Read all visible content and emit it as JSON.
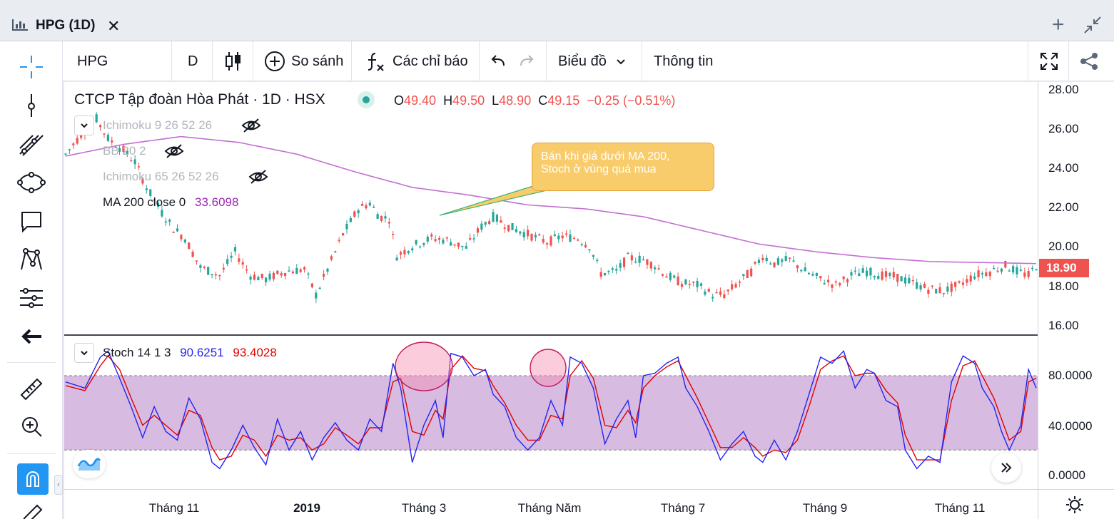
{
  "window": {
    "title": "HPG (1D)",
    "close_glyph": "✕",
    "add_glyph": "+"
  },
  "toolbar": {
    "symbol": "HPG",
    "interval": "D",
    "compare_label": "So sánh",
    "indicators_label": "Các chỉ báo",
    "chart_type_label": "Biểu đồ",
    "info_label": "Thông tin",
    "icons": [
      "candles-icon",
      "add-circle-icon",
      "fx-icon",
      "undo-icon",
      "redo-icon",
      "chevron-down-icon",
      "fullscreen-icon",
      "share-icon"
    ]
  },
  "left_tools": [
    "crosshair-icon",
    "trendline-icon",
    "fib-icon",
    "ellipse-icon",
    "comment-icon",
    "pattern-icon",
    "forecast-icon",
    "back-arrow-icon",
    "ruler-icon",
    "zoom-icon",
    "magnet-icon",
    "pencil-icon"
  ],
  "legend": {
    "title": "CTCP Tập đoàn Hòa Phát · 1D · HSX",
    "o_key": "O",
    "o_val": "49.40",
    "h_key": "H",
    "h_val": "49.50",
    "l_key": "L",
    "l_val": "48.90",
    "c_key": "C",
    "c_val": "49.15",
    "change": "−0.25 (−0.51%)"
  },
  "indicators": {
    "ichimoku1": "Ichimoku 9 26 52 26",
    "bb": "BB 20 2",
    "ichimoku2": "Ichimoku 65 26 52 26",
    "ma_label": "MA 200 close 0",
    "ma_value": "33.6098"
  },
  "stoch": {
    "label": "Stoch 14 1 3",
    "k_value": "90.6251",
    "d_value": "93.4028",
    "k_color": "#2424f0",
    "d_color": "#e00000"
  },
  "callout": {
    "line1": "Bán khi giá dưới MA 200,",
    "line2": "Stoch ở vùng quá mua"
  },
  "price_axis": {
    "ticks": [
      "28.00",
      "26.00",
      "24.00",
      "22.00",
      "20.00",
      "18.00",
      "16.00"
    ],
    "last_price": "18.90"
  },
  "stoch_axis": {
    "ticks": [
      "80.0000",
      "40.0000",
      "0.0000"
    ]
  },
  "time_axis": {
    "ticks": [
      "Tháng 11",
      "2019",
      "Tháng 3",
      "Tháng Năm",
      "Tháng 7",
      "Tháng 9",
      "Tháng 11"
    ]
  },
  "colors": {
    "up": "#26a69a",
    "down": "#ef5350",
    "ma": "#c36fd1",
    "stoch_band": "#d8bbe0",
    "accent": "#2196f3"
  },
  "chart_data": {
    "type": "line",
    "price_ylim": [
      15.5,
      28.5
    ],
    "price_waypoints": [
      [
        0,
        24.6
      ],
      [
        8,
        25.6
      ],
      [
        16,
        26.4
      ],
      [
        22,
        25.4
      ],
      [
        30,
        24.8
      ],
      [
        36,
        24.2
      ],
      [
        42,
        22.9
      ],
      [
        50,
        21.6
      ],
      [
        56,
        20.8
      ],
      [
        62,
        20.3
      ],
      [
        70,
        18.8
      ],
      [
        80,
        18.4
      ],
      [
        88,
        19.6
      ],
      [
        96,
        18.4
      ],
      [
        104,
        18.2
      ],
      [
        114,
        18.6
      ],
      [
        124,
        18.7
      ],
      [
        130,
        17.4
      ],
      [
        136,
        18.7
      ],
      [
        144,
        20.5
      ],
      [
        152,
        21.8
      ],
      [
        158,
        22.1
      ],
      [
        163,
        21.4
      ],
      [
        168,
        21.3
      ],
      [
        172,
        19.4
      ],
      [
        180,
        19.9
      ],
      [
        190,
        20.3
      ],
      [
        198,
        20.2
      ],
      [
        208,
        19.8
      ],
      [
        216,
        20.9
      ],
      [
        222,
        21.4
      ],
      [
        230,
        20.9
      ],
      [
        240,
        20.5
      ],
      [
        250,
        20.1
      ],
      [
        258,
        20.4
      ],
      [
        266,
        20.3
      ],
      [
        272,
        19.9
      ],
      [
        278,
        18.5
      ],
      [
        286,
        18.6
      ],
      [
        292,
        19.3
      ],
      [
        300,
        19.2
      ],
      [
        306,
        18.9
      ],
      [
        312,
        18.4
      ],
      [
        320,
        18.0
      ],
      [
        328,
        17.9
      ],
      [
        336,
        17.4
      ],
      [
        342,
        17.4
      ],
      [
        348,
        17.9
      ],
      [
        356,
        18.6
      ],
      [
        362,
        19.4
      ],
      [
        368,
        19.0
      ],
      [
        376,
        19.2
      ],
      [
        384,
        18.6
      ],
      [
        392,
        18.2
      ],
      [
        400,
        17.9
      ],
      [
        408,
        18.4
      ],
      [
        416,
        18.6
      ],
      [
        424,
        18.4
      ],
      [
        432,
        18.3
      ],
      [
        440,
        18.0
      ],
      [
        448,
        17.7
      ],
      [
        456,
        17.6
      ],
      [
        464,
        17.9
      ],
      [
        472,
        18.4
      ],
      [
        480,
        18.6
      ],
      [
        488,
        18.9
      ],
      [
        494,
        18.6
      ],
      [
        500,
        18.4
      ],
      [
        504,
        18.9
      ]
    ],
    "ma200_waypoints": [
      [
        0,
        24.5
      ],
      [
        30,
        25.1
      ],
      [
        60,
        25.5
      ],
      [
        90,
        25.2
      ],
      [
        120,
        24.6
      ],
      [
        150,
        23.7
      ],
      [
        180,
        22.9
      ],
      [
        210,
        22.5
      ],
      [
        240,
        22.0
      ],
      [
        270,
        21.8
      ],
      [
        300,
        21.4
      ],
      [
        330,
        20.7
      ],
      [
        360,
        20.0
      ],
      [
        390,
        19.6
      ],
      [
        420,
        19.3
      ],
      [
        450,
        19.1
      ],
      [
        480,
        19.05
      ],
      [
        504,
        19.0
      ]
    ],
    "stoch_ylim": [
      -5,
      110
    ],
    "stoch_overbought": 80,
    "stoch_oversold": 20,
    "stoch_k_waypoints": [
      [
        0,
        75
      ],
      [
        10,
        70
      ],
      [
        18,
        95
      ],
      [
        22,
        100
      ],
      [
        28,
        78
      ],
      [
        34,
        55
      ],
      [
        40,
        30
      ],
      [
        46,
        55
      ],
      [
        52,
        35
      ],
      [
        58,
        28
      ],
      [
        64,
        62
      ],
      [
        70,
        45
      ],
      [
        76,
        10
      ],
      [
        80,
        5
      ],
      [
        86,
        20
      ],
      [
        92,
        40
      ],
      [
        98,
        22
      ],
      [
        104,
        8
      ],
      [
        110,
        45
      ],
      [
        116,
        20
      ],
      [
        122,
        35
      ],
      [
        128,
        12
      ],
      [
        134,
        30
      ],
      [
        140,
        42
      ],
      [
        146,
        28
      ],
      [
        152,
        20
      ],
      [
        158,
        45
      ],
      [
        164,
        35
      ],
      [
        170,
        90
      ],
      [
        174,
        70
      ],
      [
        180,
        10
      ],
      [
        186,
        40
      ],
      [
        192,
        60
      ],
      [
        196,
        30
      ],
      [
        200,
        98
      ],
      [
        206,
        95
      ],
      [
        212,
        80
      ],
      [
        218,
        85
      ],
      [
        222,
        65
      ],
      [
        228,
        55
      ],
      [
        234,
        30
      ],
      [
        240,
        20
      ],
      [
        246,
        30
      ],
      [
        252,
        60
      ],
      [
        258,
        40
      ],
      [
        262,
        95
      ],
      [
        268,
        90
      ],
      [
        274,
        70
      ],
      [
        280,
        25
      ],
      [
        286,
        45
      ],
      [
        292,
        60
      ],
      [
        296,
        30
      ],
      [
        300,
        80
      ],
      [
        306,
        82
      ],
      [
        312,
        90
      ],
      [
        318,
        95
      ],
      [
        322,
        70
      ],
      [
        328,
        55
      ],
      [
        334,
        35
      ],
      [
        340,
        12
      ],
      [
        346,
        25
      ],
      [
        352,
        35
      ],
      [
        358,
        15
      ],
      [
        362,
        10
      ],
      [
        368,
        28
      ],
      [
        374,
        12
      ],
      [
        380,
        35
      ],
      [
        386,
        65
      ],
      [
        392,
        95
      ],
      [
        398,
        90
      ],
      [
        404,
        100
      ],
      [
        410,
        70
      ],
      [
        416,
        85
      ],
      [
        420,
        82
      ],
      [
        426,
        60
      ],
      [
        432,
        55
      ],
      [
        436,
        20
      ],
      [
        442,
        5
      ],
      [
        448,
        15
      ],
      [
        454,
        10
      ],
      [
        460,
        75
      ],
      [
        466,
        96
      ],
      [
        472,
        90
      ],
      [
        476,
        70
      ],
      [
        482,
        55
      ],
      [
        486,
        35
      ],
      [
        490,
        20
      ],
      [
        496,
        40
      ],
      [
        500,
        85
      ],
      [
        504,
        70
      ]
    ],
    "stoch_d_waypoints": [
      [
        0,
        72
      ],
      [
        10,
        68
      ],
      [
        18,
        88
      ],
      [
        22,
        96
      ],
      [
        28,
        85
      ],
      [
        34,
        62
      ],
      [
        40,
        40
      ],
      [
        46,
        48
      ],
      [
        52,
        40
      ],
      [
        58,
        32
      ],
      [
        64,
        52
      ],
      [
        70,
        48
      ],
      [
        76,
        22
      ],
      [
        80,
        12
      ],
      [
        86,
        15
      ],
      [
        92,
        32
      ],
      [
        98,
        28
      ],
      [
        104,
        15
      ],
      [
        110,
        32
      ],
      [
        116,
        28
      ],
      [
        122,
        30
      ],
      [
        128,
        20
      ],
      [
        134,
        25
      ],
      [
        140,
        38
      ],
      [
        146,
        32
      ],
      [
        152,
        25
      ],
      [
        158,
        38
      ],
      [
        164,
        38
      ],
      [
        170,
        75
      ],
      [
        174,
        78
      ],
      [
        180,
        35
      ],
      [
        186,
        32
      ],
      [
        192,
        52
      ],
      [
        196,
        45
      ],
      [
        200,
        85
      ],
      [
        206,
        96
      ],
      [
        212,
        86
      ],
      [
        218,
        84
      ],
      [
        222,
        72
      ],
      [
        228,
        58
      ],
      [
        234,
        40
      ],
      [
        240,
        28
      ],
      [
        246,
        28
      ],
      [
        252,
        48
      ],
      [
        258,
        45
      ],
      [
        262,
        80
      ],
      [
        268,
        92
      ],
      [
        274,
        78
      ],
      [
        280,
        40
      ],
      [
        286,
        38
      ],
      [
        292,
        52
      ],
      [
        296,
        42
      ],
      [
        300,
        70
      ],
      [
        306,
        80
      ],
      [
        312,
        87
      ],
      [
        318,
        92
      ],
      [
        322,
        80
      ],
      [
        328,
        62
      ],
      [
        334,
        42
      ],
      [
        340,
        22
      ],
      [
        346,
        22
      ],
      [
        352,
        30
      ],
      [
        358,
        22
      ],
      [
        362,
        15
      ],
      [
        368,
        20
      ],
      [
        374,
        18
      ],
      [
        380,
        28
      ],
      [
        386,
        55
      ],
      [
        392,
        85
      ],
      [
        398,
        92
      ],
      [
        404,
        96
      ],
      [
        410,
        80
      ],
      [
        416,
        82
      ],
      [
        420,
        82
      ],
      [
        426,
        68
      ],
      [
        432,
        58
      ],
      [
        436,
        32
      ],
      [
        442,
        12
      ],
      [
        448,
        12
      ],
      [
        454,
        12
      ],
      [
        460,
        60
      ],
      [
        466,
        88
      ],
      [
        472,
        92
      ],
      [
        476,
        80
      ],
      [
        482,
        62
      ],
      [
        486,
        45
      ],
      [
        490,
        28
      ],
      [
        496,
        35
      ],
      [
        500,
        75
      ],
      [
        504,
        78
      ]
    ]
  }
}
